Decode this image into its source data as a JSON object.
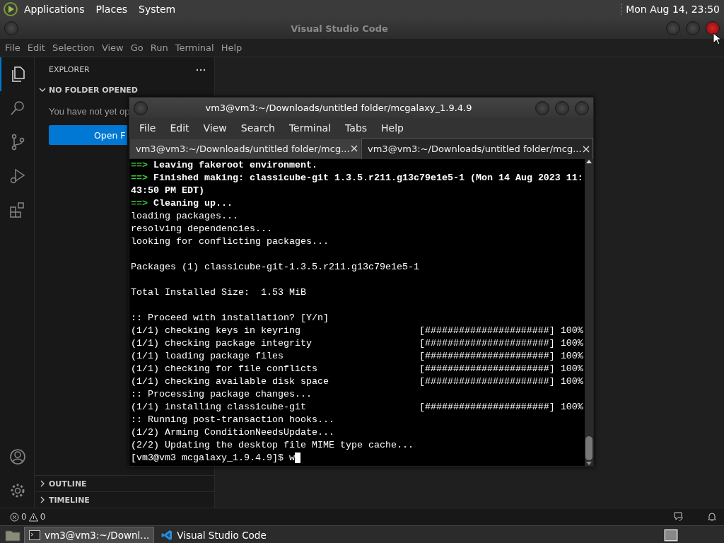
{
  "top_panel": {
    "menus": [
      "Applications",
      "Places",
      "System"
    ],
    "clock": "Mon Aug 14, 23:50"
  },
  "vscode": {
    "title": "Visual Studio Code",
    "menu": [
      "File",
      "Edit",
      "Selection",
      "View",
      "Go",
      "Run",
      "Terminal",
      "Help"
    ],
    "activity_bar": [
      {
        "kind": "files",
        "selected": true
      },
      {
        "kind": "search",
        "selected": false
      },
      {
        "kind": "source-control",
        "selected": false
      },
      {
        "kind": "run",
        "selected": false
      },
      {
        "kind": "extensions",
        "selected": false
      }
    ],
    "activity_bottom": [
      {
        "kind": "account"
      },
      {
        "kind": "settings"
      }
    ],
    "sidebar": {
      "title": "EXPLORER",
      "sections": [
        {
          "title": "NO FOLDER OPENED",
          "expanded": true
        },
        {
          "title": "OUTLINE",
          "expanded": false
        },
        {
          "title": "TIMELINE",
          "expanded": false
        }
      ],
      "message": "You have not yet op",
      "button": "Open F"
    },
    "status_bar": {
      "errors": "0",
      "warnings": "0"
    }
  },
  "terminal": {
    "title": "vm3@vm3:~/Downloads/untitled folder/mcgalaxy_1.9.4.9",
    "menu": [
      "File",
      "Edit",
      "View",
      "Search",
      "Terminal",
      "Tabs",
      "Help"
    ],
    "tabs": [
      {
        "label": "vm3@vm3:~/Downloads/untitled folder/mcg...",
        "selected": false
      },
      {
        "label": "vm3@vm3:~/Downloads/untitled folder/mcg...",
        "selected": true
      }
    ],
    "lines": [
      {
        "kind": "arrow",
        "prefix": "==>",
        "text": "Leaving fakeroot environment."
      },
      {
        "kind": "arrow",
        "prefix": "==>",
        "text": "Finished making: classicube-git 1.3.5.r211.g13c79e1e5-1 (Mon 14 Aug 2023 11:43:50 PM EDT)"
      },
      {
        "kind": "arrow",
        "prefix": "==>",
        "text": "Cleaning up..."
      },
      {
        "kind": "plain",
        "text": "loading packages..."
      },
      {
        "kind": "plain",
        "text": "resolving dependencies..."
      },
      {
        "kind": "plain",
        "text": "looking for conflicting packages..."
      },
      {
        "kind": "blank"
      },
      {
        "kind": "plain",
        "text": "Packages (1) classicube-git-1.3.5.r211.g13c79e1e5-1"
      },
      {
        "kind": "blank"
      },
      {
        "kind": "plain",
        "text": "Total Installed Size:  1.53 MiB"
      },
      {
        "kind": "blank"
      },
      {
        "kind": "plain",
        "text": ":: Proceed with installation? [Y/n]"
      },
      {
        "kind": "progress",
        "text": "(1/1) checking keys in keyring",
        "bar": "[######################]",
        "percent": "100%"
      },
      {
        "kind": "progress",
        "text": "(1/1) checking package integrity",
        "bar": "[######################]",
        "percent": "100%"
      },
      {
        "kind": "progress",
        "text": "(1/1) loading package files",
        "bar": "[######################]",
        "percent": "100%"
      },
      {
        "kind": "progress",
        "text": "(1/1) checking for file conflicts",
        "bar": "[######################]",
        "percent": "100%"
      },
      {
        "kind": "progress",
        "text": "(1/1) checking available disk space",
        "bar": "[######################]",
        "percent": "100%"
      },
      {
        "kind": "plain",
        "text": ":: Processing package changes..."
      },
      {
        "kind": "progress",
        "text": "(1/1) installing classicube-git",
        "bar": "[######################]",
        "percent": "100%"
      },
      {
        "kind": "plain",
        "text": ":: Running post-transaction hooks..."
      },
      {
        "kind": "plain",
        "text": "(1/2) Arming ConditionNeedsUpdate..."
      },
      {
        "kind": "plain",
        "text": "(2/2) Updating the desktop file MIME type cache..."
      },
      {
        "kind": "prompt",
        "prompt": "[vm3@vm3 mcgalaxy_1.9.4.9]$",
        "typed": "w"
      }
    ]
  },
  "taskbar": {
    "tasks": [
      {
        "kind": "terminal",
        "label": "vm3@vm3:~/Downl...",
        "selected": true
      },
      {
        "kind": "vscode",
        "label": "Visual Studio Code",
        "selected": false
      }
    ]
  }
}
